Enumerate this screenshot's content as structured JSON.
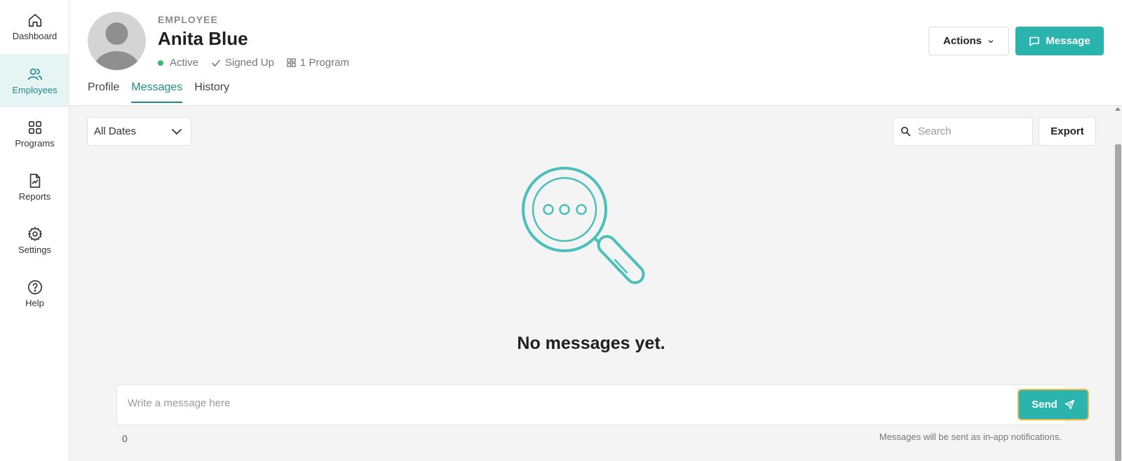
{
  "sidebar": {
    "items": [
      {
        "label": "Dashboard",
        "icon": "home-icon"
      },
      {
        "label": "Employees",
        "icon": "users-icon"
      },
      {
        "label": "Programs",
        "icon": "grid-icon"
      },
      {
        "label": "Reports",
        "icon": "report-icon"
      },
      {
        "label": "Settings",
        "icon": "gear-icon"
      },
      {
        "label": "Help",
        "icon": "help-icon"
      }
    ],
    "active": "Employees"
  },
  "profile": {
    "eyebrow": "EMPLOYEE",
    "name": "Anita Blue",
    "status": "Active",
    "signup": "Signed Up",
    "programs": "1 Program"
  },
  "tabs": [
    "Profile",
    "Messages",
    "History"
  ],
  "active_tab": "Messages",
  "header_buttons": {
    "actions": "Actions",
    "message": "Message"
  },
  "toolbar": {
    "date_filter": "All Dates",
    "search_placeholder": "Search",
    "export": "Export"
  },
  "empty_state": {
    "title": "No messages yet.",
    "icon": "magnifier-chat-icon"
  },
  "composer": {
    "placeholder": "Write a message here",
    "send": "Send",
    "char_count": "0",
    "hint": "Messages will be sent as in-app notifications."
  },
  "colors": {
    "accent": "#2bb3ad",
    "accent_text": "#1f8a85",
    "status_active": "#3dbb6a",
    "focus_ring": "#e8b84a",
    "illustration": "#4bc0bb"
  }
}
